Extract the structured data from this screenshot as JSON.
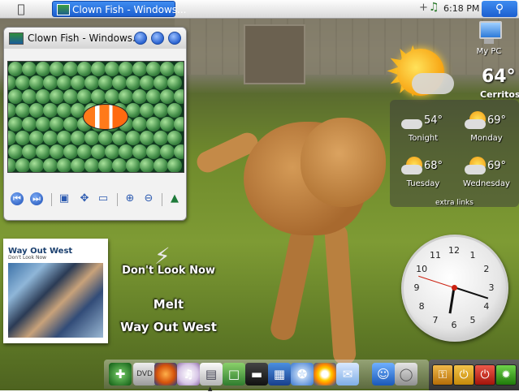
{
  "menubar": {
    "apple_menu_icon": "apple-logo-icon",
    "active_window_label": "Clown Fish - Windows...",
    "tray_icons": [
      "plus-icon",
      "music-note-icon"
    ],
    "clock_text": "6:18 PM",
    "search_icon": "magnifier-icon"
  },
  "media_window": {
    "title": "Clown Fish - Windows...",
    "window_buttons": [
      "minimize-icon",
      "maximize-icon",
      "close-icon"
    ],
    "controls": [
      "previous-icon",
      "next-icon",
      "fit-screen-icon",
      "fullscreen-icon",
      "slideshow-icon",
      "zoom-in-icon",
      "zoom-out-icon",
      "rotate-icon"
    ]
  },
  "now_playing": {
    "album_cover_title": "Way Out West",
    "album_cover_subtitle": "Don't Look Now",
    "track_line": "Don't Look Now",
    "artist_line": "Melt",
    "album_line": "Way Out West"
  },
  "desktop_icons": [
    {
      "label": "My PC",
      "icon": "computer-monitor-icon"
    }
  ],
  "weather": {
    "current_temp": "64°",
    "city": "Cerritos",
    "forecast": [
      {
        "temp": "54°",
        "day": "Tonight",
        "icon": "cloudy-icon"
      },
      {
        "temp": "69°",
        "day": "Monday",
        "icon": "partly-sunny-icon"
      },
      {
        "temp": "68°",
        "day": "Tuesday",
        "icon": "partly-sunny-icon"
      },
      {
        "temp": "69°",
        "day": "Wednesday",
        "icon": "partly-sunny-icon"
      }
    ],
    "extra_links": "extra links"
  },
  "analog_clock": {
    "numerals": [
      "12",
      "1",
      "2",
      "3",
      "4",
      "5",
      "6",
      "7",
      "8",
      "9",
      "10",
      "11"
    ],
    "hour": 6,
    "minute": 18
  },
  "dock": {
    "items": [
      "radar-icon",
      "dvd-player-icon",
      "firefox-icon",
      "itunes-icon",
      "preview-icon",
      "iphoto-icon",
      "imovie-icon",
      "frontrow-icon",
      "safari-icon",
      "quicktime-icon",
      "mail-icon",
      "finder-icon",
      "trash-icon"
    ]
  },
  "system_panel": {
    "items": [
      "key-icon",
      "sleep-icon",
      "power-icon",
      "light-icon"
    ]
  },
  "colors": {
    "menubar_accent": "#1c5fd0",
    "system_panel": "#333333"
  }
}
